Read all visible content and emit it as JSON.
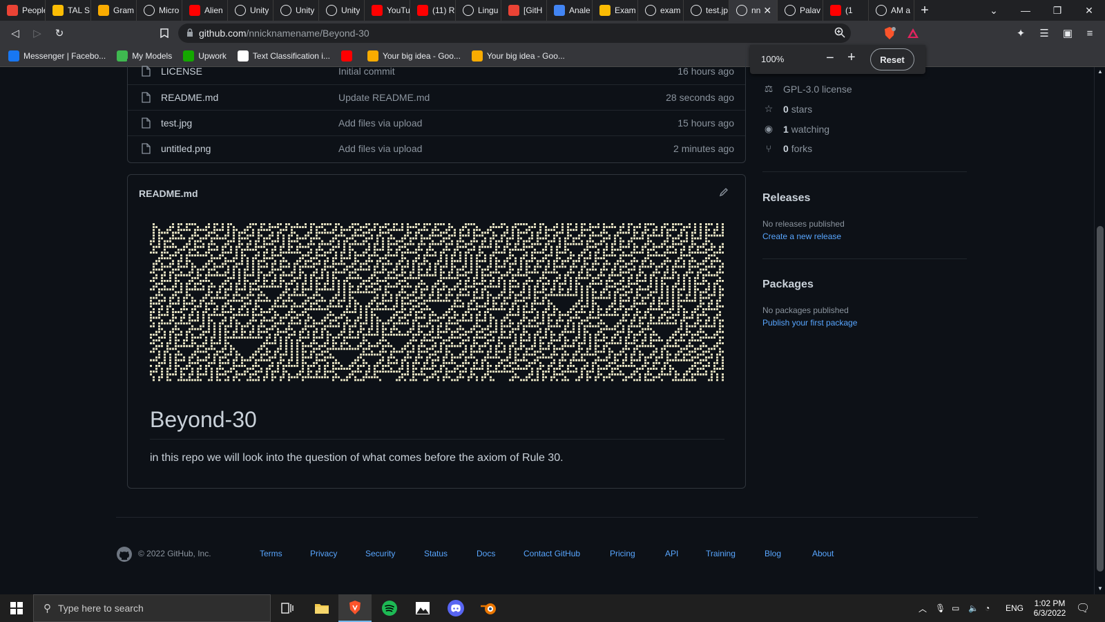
{
  "browser": {
    "tabs": [
      {
        "label": "People",
        "favicon": "gmail-icon",
        "color": "#ea4335"
      },
      {
        "label": "TAL S",
        "favicon": "drive-icon",
        "color": "#fbbc04"
      },
      {
        "label": "Gram",
        "favicon": "slides-icon",
        "color": "#f9ab00"
      },
      {
        "label": "Micro",
        "favicon": "github-icon",
        "color": "#e8eaed"
      },
      {
        "label": "Alien",
        "favicon": "youtube-icon",
        "color": "#ff0000"
      },
      {
        "label": "Unity",
        "favicon": "unity-icon",
        "color": "#e8eaed"
      },
      {
        "label": "Unity",
        "favicon": "unity-icon",
        "color": "#e8eaed"
      },
      {
        "label": "Unity",
        "favicon": "unity-icon",
        "color": "#e8eaed"
      },
      {
        "label": "YouTu",
        "favicon": "youtube-icon",
        "color": "#ff0000"
      },
      {
        "label": "(11) R",
        "favicon": "youtube-icon",
        "color": "#ff0000"
      },
      {
        "label": "Lingu",
        "favicon": "github-icon",
        "color": "#e8eaed"
      },
      {
        "label": "[GitH",
        "favicon": "gmail-icon",
        "color": "#ea4335"
      },
      {
        "label": "Anale",
        "favicon": "contacts-icon",
        "color": "#4285f4"
      },
      {
        "label": "Exam",
        "favicon": "drive-icon",
        "color": "#fbbc04"
      },
      {
        "label": "exam",
        "favicon": "github-icon",
        "color": "#e8eaed"
      },
      {
        "label": "test.jp",
        "favicon": "github-icon",
        "color": "#e8eaed"
      },
      {
        "label": "nn",
        "favicon": "github-icon",
        "color": "#e8eaed",
        "active": true
      },
      {
        "label": "Palav",
        "favicon": "news-icon",
        "color": "#e8eaed"
      },
      {
        "label": "(1",
        "favicon": "youtube-icon",
        "color": "#ff0000"
      },
      {
        "label": "AM a",
        "favicon": "openai-icon",
        "color": "#e8eaed"
      }
    ],
    "url_host": "github.com",
    "url_path": "/nnicknamename/Beyond-30",
    "bookmarks": [
      {
        "label": "Messenger | Facebo...",
        "icon": "facebook-icon",
        "color": "#1877f2"
      },
      {
        "label": "My Models",
        "icon": "models-icon",
        "color": "#3fb950"
      },
      {
        "label": "Upwork",
        "icon": "upwork-icon",
        "color": "#14a800"
      },
      {
        "label": "Text Classification i...",
        "icon": "doc-icon",
        "color": "#ffffff"
      },
      {
        "label": "",
        "icon": "youtube-icon",
        "color": "#ff0000"
      },
      {
        "label": "Your big idea - Goo...",
        "icon": "slides-icon",
        "color": "#f9ab00"
      },
      {
        "label": "Your big idea - Goo...",
        "icon": "slides-icon",
        "color": "#f9ab00"
      }
    ],
    "zoom": {
      "level": "100%",
      "minus": "−",
      "plus": "+",
      "reset": "Reset"
    }
  },
  "files": [
    {
      "name": "LICENSE",
      "message": "Initial commit",
      "age": "16 hours ago"
    },
    {
      "name": "README.md",
      "message": "Update README.md",
      "age": "28 seconds ago"
    },
    {
      "name": "test.jpg",
      "message": "Add files via upload",
      "age": "15 hours ago"
    },
    {
      "name": "untitled.png",
      "message": "Add files via upload",
      "age": "2 minutes ago"
    }
  ],
  "readme": {
    "filename": "README.md",
    "heading": "Beyond-30",
    "description": "in this repo we will look into the question of what comes before the axiom of Rule 30."
  },
  "sidebar": {
    "license": "GPL-3.0 license",
    "stars_count": "0",
    "stars_label": "stars",
    "watching_count": "1",
    "watching_label": "watching",
    "forks_count": "0",
    "forks_label": "forks",
    "releases_title": "Releases",
    "releases_empty": "No releases published",
    "releases_link": "Create a new release",
    "packages_title": "Packages",
    "packages_empty": "No packages published",
    "packages_link": "Publish your first package"
  },
  "footer": {
    "copyright": "© 2022 GitHub, Inc.",
    "links": [
      "Terms",
      "Privacy",
      "Security",
      "Status",
      "Docs",
      "Contact GitHub",
      "Pricing",
      "API",
      "Training",
      "Blog",
      "About"
    ]
  },
  "taskbar": {
    "search_placeholder": "Type here to search",
    "apps": [
      "task-view-icon",
      "file-explorer-icon",
      "brave-icon",
      "spotify-icon",
      "photos-icon",
      "discord-icon",
      "blender-icon"
    ],
    "language": "ENG",
    "time": "1:02 PM",
    "date": "6/3/2022"
  },
  "colors": {
    "page_bg": "#0d1117",
    "border": "#30363d",
    "text": "#c9d1d9",
    "muted": "#8b949e",
    "link": "#58a6ff",
    "pattern_cell": "#e8e4c4"
  }
}
